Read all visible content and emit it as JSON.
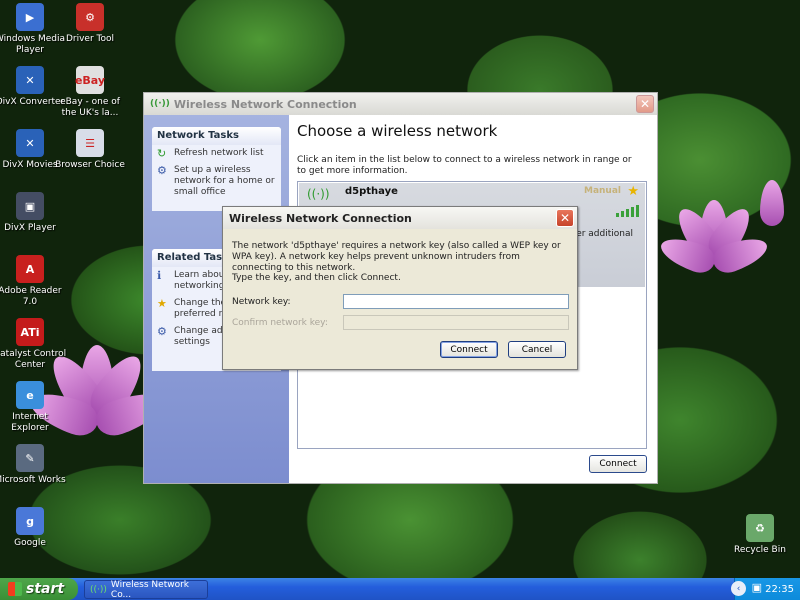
{
  "desktop": {
    "icons_left": [
      {
        "label": "Windows Media Player",
        "glyph": "▶",
        "color": "#3b6fd1"
      },
      {
        "label": "DivX Converter",
        "glyph": "✕",
        "color": "#2a62b8"
      },
      {
        "label": "DivX Movies",
        "glyph": "✕",
        "color": "#2a62b8"
      },
      {
        "label": "DivX Player",
        "glyph": "▣",
        "color": "#444d63"
      },
      {
        "label": "Adobe Reader 7.0",
        "glyph": "A",
        "color": "#c8201e"
      },
      {
        "label": "Catalyst Control Center",
        "glyph": "ATi",
        "color": "#c41b1b"
      },
      {
        "label": "Internet Explorer",
        "glyph": "e",
        "color": "#3a8fdc"
      },
      {
        "label": "Microsoft Works",
        "glyph": "✎",
        "color": "#5a6a80"
      },
      {
        "label": "Google",
        "glyph": "g",
        "color": "#4a78d8"
      }
    ],
    "icons_col2": [
      {
        "label": "Driver Tool",
        "glyph": "⚙",
        "color": "#c8302a"
      },
      {
        "label": "eBay - one of the UK's la...",
        "glyph": "eBay",
        "color": "#e0e0e0"
      },
      {
        "label": "Browser Choice",
        "glyph": "☰",
        "color": "#d8dde8"
      }
    ],
    "recycle_bin": {
      "label": "Recycle Bin",
      "glyph": "♻",
      "color": "#cfe8cf"
    }
  },
  "main_window": {
    "title": "Wireless Network Connection",
    "title_icon": "wireless-icon",
    "close_glyph": "✕",
    "network_tasks": {
      "header": "Network Tasks",
      "items": [
        {
          "label": "Refresh network list",
          "icon": "refresh-icon",
          "glyph": "↻"
        },
        {
          "label": "Set up a wireless network for a home or small office",
          "icon": "setup-icon",
          "glyph": "⚙"
        }
      ]
    },
    "related_tasks": {
      "header": "Related Tasks",
      "items": [
        {
          "label": "Learn about wireless networking",
          "icon": "info-icon",
          "glyph": "ℹ"
        },
        {
          "label": "Change the order of preferred networks",
          "icon": "star-icon",
          "glyph": "★"
        },
        {
          "label": "Change advanced settings",
          "icon": "settings-icon",
          "glyph": "⚙"
        }
      ]
    },
    "heading": "Choose a wireless network",
    "description": "Click an item in the list below to connect to a wireless network in range or to get more information.",
    "network": {
      "name": "d5pthaye",
      "status": "Manual",
      "detail_partial": "enter additional",
      "signal_bars": 5
    },
    "connect_label": "Connect"
  },
  "dialog": {
    "title": "Wireless Network Connection",
    "message": "The network 'd5pthaye' requires a network key (also called a WEP key or WPA key). A network key helps prevent unknown intruders from connecting to this network.",
    "instruction": "Type the key, and then click Connect.",
    "network_key_label": "Network key:",
    "network_key_value": "",
    "confirm_key_label": "Confirm network key:",
    "confirm_key_value": "",
    "connect_label": "Connect",
    "cancel_label": "Cancel",
    "close_glyph": "✕"
  },
  "taskbar": {
    "start_label": "start",
    "task_button_label": "Wireless Network Co...",
    "clock": "22:35",
    "tray_arrow": "‹",
    "tray_icon": "network-tray-icon"
  },
  "colors": {
    "xp_blue": "#245edc",
    "start_green": "#3a8f36",
    "close_red": "#c7432a"
  }
}
